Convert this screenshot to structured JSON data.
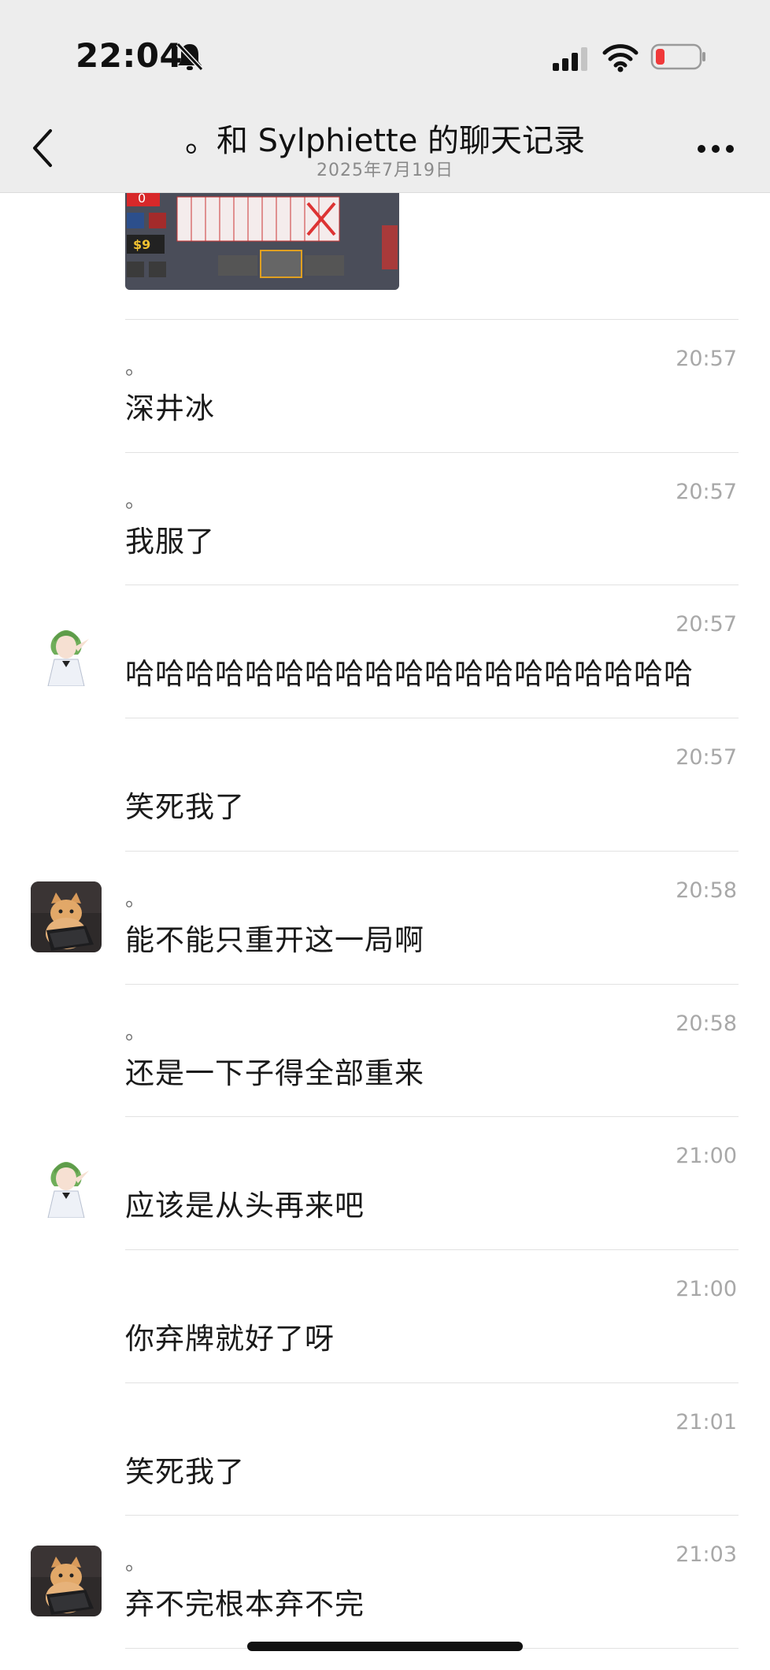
{
  "status_bar": {
    "time": "22:04"
  },
  "nav": {
    "title": "。和 Sylphiette 的聊天记录",
    "date": "2025年7月19日"
  },
  "shared_image": {
    "description_icon": "game-screenshot"
  },
  "messages": [
    {
      "avatar": "none",
      "sender": "。",
      "time": "20:57",
      "text": "深井冰"
    },
    {
      "avatar": "none",
      "sender": "。",
      "time": "20:57",
      "text": "我服了"
    },
    {
      "avatar": "sylphiette-avatar",
      "sender": "",
      "time": "20:57",
      "text": "哈哈哈哈哈哈哈哈哈哈哈哈哈哈哈哈哈哈哈"
    },
    {
      "avatar": "none",
      "sender": "",
      "time": "20:57",
      "text": "笑死我了"
    },
    {
      "avatar": "cat-avatar",
      "sender": "。",
      "time": "20:58",
      "text": "能不能只重开这一局啊"
    },
    {
      "avatar": "none",
      "sender": "。",
      "time": "20:58",
      "text": "还是一下子得全部重来"
    },
    {
      "avatar": "sylphiette-avatar",
      "sender": "",
      "time": "21:00",
      "text": "应该是从头再来吧"
    },
    {
      "avatar": "none",
      "sender": "",
      "time": "21:00",
      "text": "你弃牌就好了呀"
    },
    {
      "avatar": "none",
      "sender": "",
      "time": "21:01",
      "text": "笑死我了"
    },
    {
      "avatar": "cat-avatar",
      "sender": "。",
      "time": "21:03",
      "text": "弃不完根本弃不完"
    }
  ]
}
